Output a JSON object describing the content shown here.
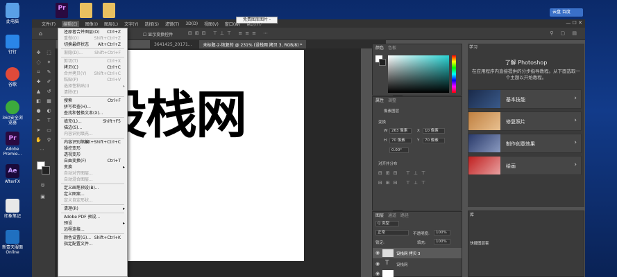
{
  "desktop": {
    "icons": [
      {
        "label": "此电脑",
        "color": "#5aa0e6"
      },
      {
        "label": "钉钉",
        "color": "#2a86e8"
      },
      {
        "label": "谷歌",
        "color": "#e04a3a"
      },
      {
        "label": "360安全浏览器",
        "color": "#3caa3c"
      },
      {
        "label": "Adobe Premie...",
        "color": "#2a0a40"
      },
      {
        "label": "AfterFX",
        "color": "#1a0a3a"
      },
      {
        "label": "印象笔记",
        "color": "#e8e8e8"
      },
      {
        "label": "新壹天服面Online",
        "color": "#2070c0"
      }
    ],
    "top_tiles": [
      {
        "label": "",
        "color": "#5aa0e6"
      },
      {
        "label": "Pr",
        "color": "#2a0a40"
      },
      {
        "label": "",
        "color": "#e8c060"
      },
      {
        "label": "",
        "color": "#e8c060"
      }
    ],
    "pr_icon_text": "Pr",
    "ae_icon_text": "Ae"
  },
  "cloud_button": "云盘 百度",
  "title_popup": "免费图库图片 - Pexels",
  "menubar": [
    "文件(F)",
    "编辑(E)",
    "图像(I)",
    "图层(L)",
    "文字(Y)",
    "选择(S)",
    "滤镜(T)",
    "3D(D)",
    "视图(V)",
    "窗口(W)",
    "帮助(H)"
  ],
  "options_bar": {
    "label": "显示变换控件"
  },
  "doc_tabs": [
    "3641425_20171...",
    "未标题-2-恢复的 @ 231% (设栈网 拷贝 3, RGB/8) *"
  ],
  "canvas_text": "设栈网",
  "edit_menu": [
    {
      "label": "还原者合并图层(O)",
      "sc": "Ctrl+Z"
    },
    {
      "label": "重做(O)",
      "sc": "Shift+Ctrl+Z",
      "dis": true
    },
    {
      "label": "切换最终状态",
      "sc": "Alt+Ctrl+Z"
    },
    {
      "sep": true
    },
    {
      "label": "渐隐(D)...",
      "sc": "Shift+Ctrl+F",
      "dis": true
    },
    {
      "sep": true
    },
    {
      "label": "剪切(T)",
      "sc": "Ctrl+X",
      "dis": true
    },
    {
      "label": "拷贝(C)",
      "sc": "Ctrl+C"
    },
    {
      "label": "合并拷贝(Y)",
      "sc": "Shift+Ctrl+C",
      "dis": true
    },
    {
      "label": "粘贴(P)",
      "sc": "Ctrl+V",
      "dis": true
    },
    {
      "label": "选择性粘贴(I)",
      "arrow": true,
      "dis": true
    },
    {
      "label": "清除(E)",
      "dis": true
    },
    {
      "sep": true
    },
    {
      "label": "搜索",
      "sc": "Ctrl+F"
    },
    {
      "label": "拼写检查(H)..."
    },
    {
      "label": "查找和替换文本(X)..."
    },
    {
      "sep": true
    },
    {
      "label": "填充(L)...",
      "sc": "Shift+F5"
    },
    {
      "label": "描边(S)..."
    },
    {
      "label": "内容识别填充...",
      "dis": true
    },
    {
      "sep": true
    },
    {
      "label": "内容识别缩放",
      "sc": "Alt+Shift+Ctrl+C"
    },
    {
      "label": "操控变形"
    },
    {
      "label": "透视变形"
    },
    {
      "label": "自由变换(F)",
      "sc": "Ctrl+T"
    },
    {
      "label": "变换",
      "arrow": true
    },
    {
      "label": "自动对齐图层...",
      "dis": true
    },
    {
      "label": "自动混合图层...",
      "dis": true
    },
    {
      "sep": true
    },
    {
      "label": "定义画笔预设(B)..."
    },
    {
      "label": "定义图案..."
    },
    {
      "label": "定义自定形状...",
      "dis": true
    },
    {
      "sep": true
    },
    {
      "label": "清理(R)",
      "arrow": true
    },
    {
      "sep": true
    },
    {
      "label": "Adobe PDF 预设..."
    },
    {
      "label": "预设",
      "arrow": true
    },
    {
      "label": "远程连接..."
    },
    {
      "sep": true
    },
    {
      "label": "颜色设置(G)...",
      "sc": "Shift+Ctrl+K"
    },
    {
      "label": "指定配置文件..."
    }
  ],
  "color_panel": {
    "tabs": [
      "颜色",
      "色板"
    ],
    "fg": "#ffffff",
    "bg": "#222222"
  },
  "props_panel": {
    "tabs": [
      "属性",
      "调整"
    ],
    "section_label": "像素图层",
    "transform_label": "变换",
    "w_label": "W",
    "w_value": "263 像素",
    "h_label": "H",
    "h_value": "70 像素",
    "x_label": "X",
    "x_value": "10 像素",
    "y_label": "Y",
    "y_value": "70 像素",
    "angle_value": "0.00°",
    "align_label": "对齐并分布"
  },
  "layers_panel": {
    "tabs": [
      "图层",
      "通道",
      "路径"
    ],
    "kind": "Q 类型",
    "mode": "正常",
    "opacity_label": "不透明度:",
    "opacity": "100%",
    "lock_label": "锁定:",
    "fill_label": "填充:",
    "fill": "100%",
    "layers": [
      "设栈网 拷贝 3",
      "设栈网",
      ""
    ]
  },
  "learn_panel": {
    "tab": "学习",
    "title": "了解 Photoshop",
    "desc": "在应用程序内直接提供的分步指导教程。从下面选取一个主题以开始教程。",
    "cards": [
      "基本技能",
      "修复照片",
      "制作创意效果",
      "绘画"
    ],
    "lower_tab": "库",
    "lower_select": "快捷图层套"
  }
}
